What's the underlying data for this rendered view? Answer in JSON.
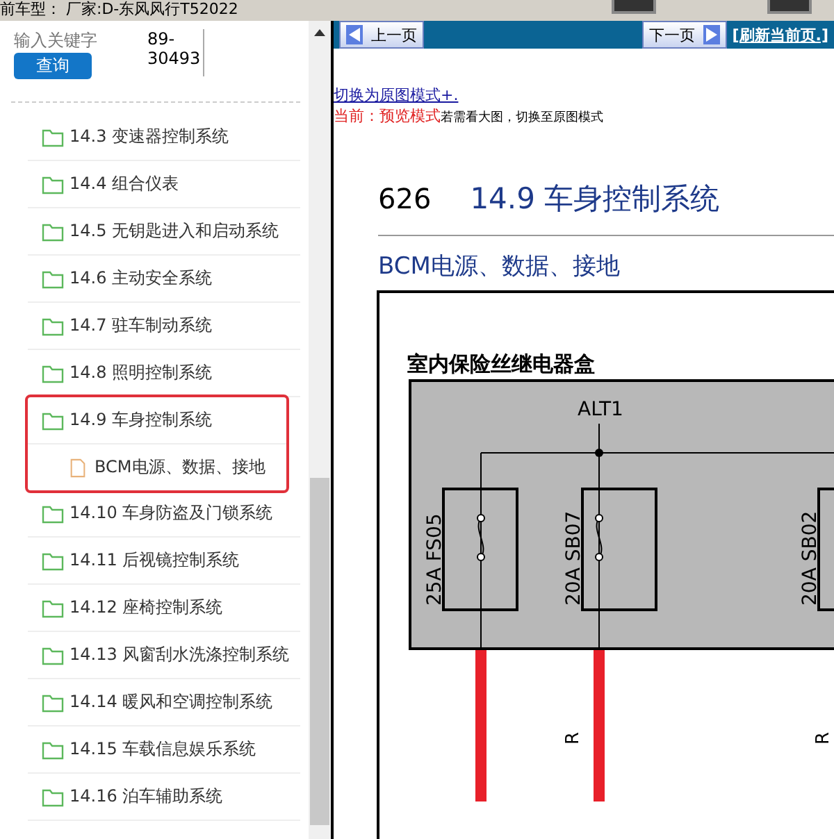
{
  "header": {
    "vehicle": "前车型： 厂家:D-东风风行T52022"
  },
  "search": {
    "label": "输入关键字",
    "value": "89-\n30493",
    "button": "查询"
  },
  "tree": [
    {
      "label": "14.3 变速器控制系统",
      "highlighted": false
    },
    {
      "label": "14.4 组合仪表",
      "highlighted": false
    },
    {
      "label": "14.5 无钥匙进入和启动系统",
      "highlighted": false
    },
    {
      "label": "14.6 主动安全系统",
      "highlighted": false
    },
    {
      "label": "14.7 驻车制动系统",
      "highlighted": false
    },
    {
      "label": "14.8 照明控制系统",
      "highlighted": false
    },
    {
      "label": "14.9 车身控制系统",
      "highlighted": true,
      "children": [
        {
          "label": "BCM电源、数据、接地"
        }
      ]
    },
    {
      "label": "14.10 车身防盗及门锁系统",
      "highlighted": false
    },
    {
      "label": "14.11 后视镜控制系统",
      "highlighted": false
    },
    {
      "label": "14.12 座椅控制系统",
      "highlighted": false
    },
    {
      "label": "14.13 风窗刮水洗涤控制系统",
      "highlighted": false
    },
    {
      "label": "14.14 暖风和空调控制系统",
      "highlighted": false
    },
    {
      "label": "14.15 车载信息娱乐系统",
      "highlighted": false
    },
    {
      "label": "14.16 泊车辅助系统",
      "highlighted": false
    }
  ],
  "nav": {
    "prev": "上一页",
    "next": "下一页",
    "refresh": "[刷新当前页.]"
  },
  "mode": {
    "switch_link": "切换为原图模式+.",
    "current": "当前：预览模式",
    "hint": "若需看大图，切换至原图模式"
  },
  "page": {
    "number": "626",
    "section": "14.9 车身控制系统",
    "subtitle": "BCM电源、数据、接地"
  },
  "diagram": {
    "box_title": "室内保险丝继电器盒",
    "source": "ALT1",
    "fuses": [
      {
        "label": "25A FS05"
      },
      {
        "label": "20A SB07"
      },
      {
        "label": "20A SB02"
      }
    ],
    "wire_labels": [
      "R",
      "R"
    ]
  }
}
